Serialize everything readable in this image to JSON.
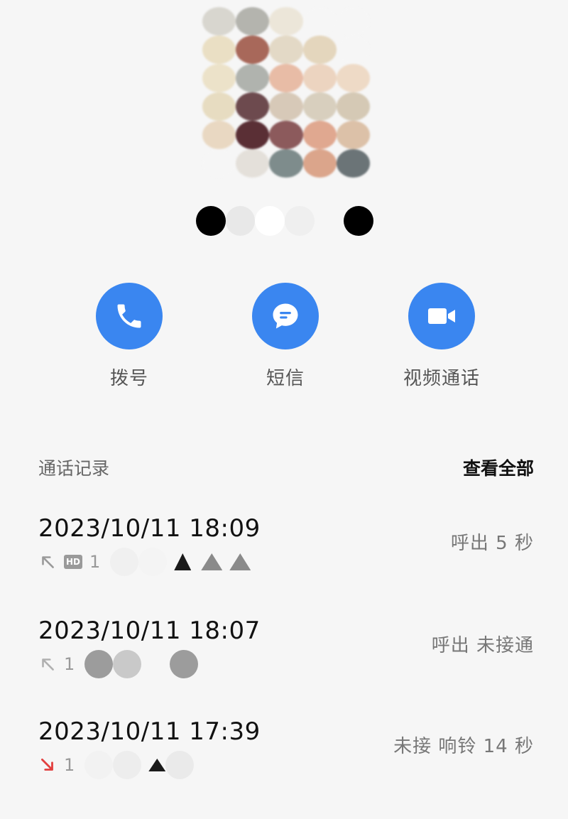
{
  "contact": {
    "avatar_icon": "contact-avatar-pixelated",
    "name_obscured": true
  },
  "actions": [
    {
      "label": "拨号",
      "icon": "phone-icon",
      "color": "#3a86f0"
    },
    {
      "label": "短信",
      "icon": "message-icon",
      "color": "#3a86f0"
    },
    {
      "label": "视频通话",
      "icon": "video-camera-icon",
      "color": "#3a86f0"
    }
  ],
  "call_log": {
    "title": "通话记录",
    "view_all": "查看全部",
    "entries": [
      {
        "time": "2023/10/11 18:09",
        "direction": "outgoing",
        "hd": true,
        "number_prefix": "1",
        "status": "呼出  5 秒"
      },
      {
        "time": "2023/10/11 18:07",
        "direction": "outgoing",
        "hd": false,
        "number_prefix": "1",
        "status": "呼出 未接通"
      },
      {
        "time": "2023/10/11 17:39",
        "direction": "missed",
        "hd": false,
        "number_prefix": "1",
        "status": "未接  响铃 14 秒"
      }
    ]
  },
  "colors": {
    "accent": "#3a86f0",
    "background": "#f6f6f6",
    "missed": "#e2403f",
    "muted_icon": "#9a9a9a"
  }
}
